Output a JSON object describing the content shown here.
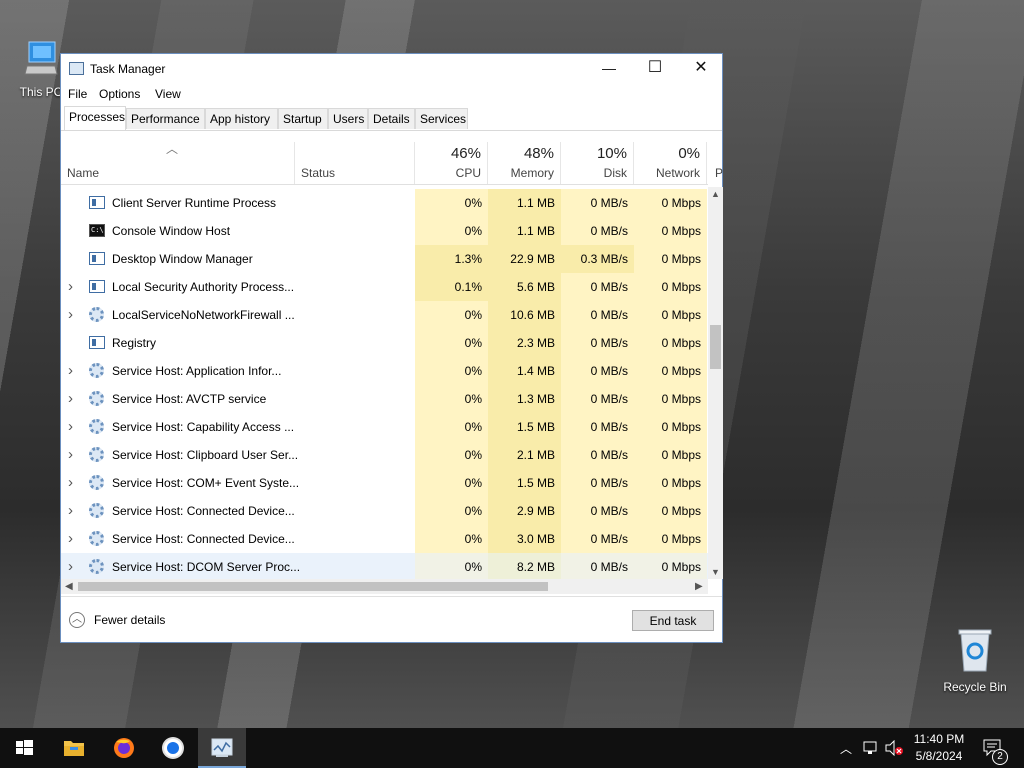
{
  "desktop": {
    "icons": [
      {
        "label": "This PC"
      },
      {
        "label": "Recycle Bin"
      }
    ]
  },
  "window": {
    "title": "Task Manager",
    "controls": {
      "minimize": "—",
      "maximize": "☐",
      "close": "✕"
    },
    "menu": [
      "File",
      "Options",
      "View"
    ],
    "tabs": [
      "Processes",
      "Performance",
      "App history",
      "Startup",
      "Users",
      "Details",
      "Services"
    ],
    "active_tab": "Processes",
    "columns": {
      "name": "Name",
      "status": "Status",
      "cpu": {
        "pct": "46%",
        "label": "CPU"
      },
      "memory": {
        "pct": "48%",
        "label": "Memory"
      },
      "disk": {
        "pct": "10%",
        "label": "Disk"
      },
      "network": {
        "pct": "0%",
        "label": "Network"
      },
      "power_partial": "P"
    },
    "processes": [
      {
        "name": "Client Server Runtime Process",
        "icon": "app-icon",
        "expand": false,
        "cpu": "0%",
        "mem": "1.1 MB",
        "disk": "0 MB/s",
        "net": "0 Mbps"
      },
      {
        "name": "Console Window Host",
        "icon": "cmd-icon",
        "expand": false,
        "cpu": "0%",
        "mem": "1.1 MB",
        "disk": "0 MB/s",
        "net": "0 Mbps"
      },
      {
        "name": "Desktop Window Manager",
        "icon": "app-icon",
        "expand": false,
        "cpu": "1.3%",
        "mem": "22.9 MB",
        "disk": "0.3 MB/s",
        "net": "0 Mbps"
      },
      {
        "name": "Local Security Authority Process...",
        "icon": "app-icon",
        "expand": true,
        "cpu": "0.1%",
        "mem": "5.6 MB",
        "disk": "0 MB/s",
        "net": "0 Mbps"
      },
      {
        "name": "LocalServiceNoNetworkFirewall ...",
        "icon": "gear-icon",
        "expand": true,
        "cpu": "0%",
        "mem": "10.6 MB",
        "disk": "0 MB/s",
        "net": "0 Mbps"
      },
      {
        "name": "Registry",
        "icon": "app-icon",
        "expand": false,
        "cpu": "0%",
        "mem": "2.3 MB",
        "disk": "0 MB/s",
        "net": "0 Mbps"
      },
      {
        "name": "Service Host: Application Infor...",
        "icon": "gear-icon",
        "expand": true,
        "cpu": "0%",
        "mem": "1.4 MB",
        "disk": "0 MB/s",
        "net": "0 Mbps"
      },
      {
        "name": "Service Host: AVCTP service",
        "icon": "gear-icon",
        "expand": true,
        "cpu": "0%",
        "mem": "1.3 MB",
        "disk": "0 MB/s",
        "net": "0 Mbps"
      },
      {
        "name": "Service Host: Capability Access ...",
        "icon": "gear-icon",
        "expand": true,
        "cpu": "0%",
        "mem": "1.5 MB",
        "disk": "0 MB/s",
        "net": "0 Mbps"
      },
      {
        "name": "Service Host: Clipboard User Ser...",
        "icon": "gear-icon",
        "expand": true,
        "cpu": "0%",
        "mem": "2.1 MB",
        "disk": "0 MB/s",
        "net": "0 Mbps"
      },
      {
        "name": "Service Host: COM+ Event Syste...",
        "icon": "gear-icon",
        "expand": true,
        "cpu": "0%",
        "mem": "1.5 MB",
        "disk": "0 MB/s",
        "net": "0 Mbps"
      },
      {
        "name": "Service Host: Connected Device...",
        "icon": "gear-icon",
        "expand": true,
        "cpu": "0%",
        "mem": "2.9 MB",
        "disk": "0 MB/s",
        "net": "0 Mbps"
      },
      {
        "name": "Service Host: Connected Device...",
        "icon": "gear-icon",
        "expand": true,
        "cpu": "0%",
        "mem": "3.0 MB",
        "disk": "0 MB/s",
        "net": "0 Mbps"
      },
      {
        "name": "Service Host: DCOM Server Proc...",
        "icon": "gear-icon",
        "expand": true,
        "cpu": "0%",
        "mem": "8.2 MB",
        "disk": "0 MB/s",
        "net": "0 Mbps",
        "selected": true
      }
    ],
    "footer": {
      "fewer_details": "Fewer details",
      "end_task": "End task"
    }
  },
  "taskbar": {
    "apps": [
      "start-icon",
      "file-explorer-icon",
      "firefox-icon",
      "chrome-icon",
      "task-manager-icon"
    ],
    "clock_time": "11:40 PM",
    "clock_date": "5/8/2024",
    "notification_count": "2"
  },
  "colors": {
    "heat_light": "#fff4c4",
    "heat_mid": "#f9ecaa",
    "selected_row": "#eaf2fb",
    "accent": "#0078d7"
  }
}
